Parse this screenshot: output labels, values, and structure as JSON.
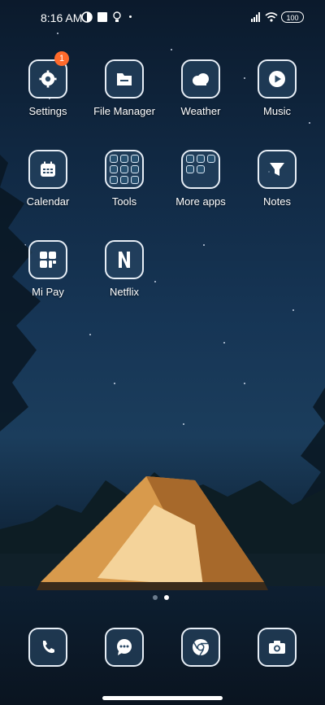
{
  "status_bar": {
    "time": "8:16 AM",
    "battery": "100"
  },
  "apps": [
    {
      "name": "Settings",
      "badge": "1",
      "icon": "gear-icon"
    },
    {
      "name": "File Manager",
      "icon": "folder-icon"
    },
    {
      "name": "Weather",
      "icon": "cloud-icon"
    },
    {
      "name": "Music",
      "icon": "play-icon"
    },
    {
      "name": "Calendar",
      "icon": "calendar-icon"
    },
    {
      "name": "Tools",
      "icon": "folder-grid-icon"
    },
    {
      "name": "More apps",
      "icon": "folder-grid-icon"
    },
    {
      "name": "Notes",
      "icon": "funnel-icon"
    },
    {
      "name": "Mi Pay",
      "icon": "grid-icon"
    },
    {
      "name": "Netflix",
      "icon": "netflix-n-icon"
    }
  ],
  "dock": [
    {
      "icon": "phone-icon"
    },
    {
      "icon": "chat-icon"
    },
    {
      "icon": "chrome-icon"
    },
    {
      "icon": "camera-icon"
    }
  ],
  "page_indicator": {
    "pages": 2,
    "active_index": 1
  },
  "colors": {
    "badge": "#ff6a2b",
    "icon_border": "#e7eef6"
  }
}
